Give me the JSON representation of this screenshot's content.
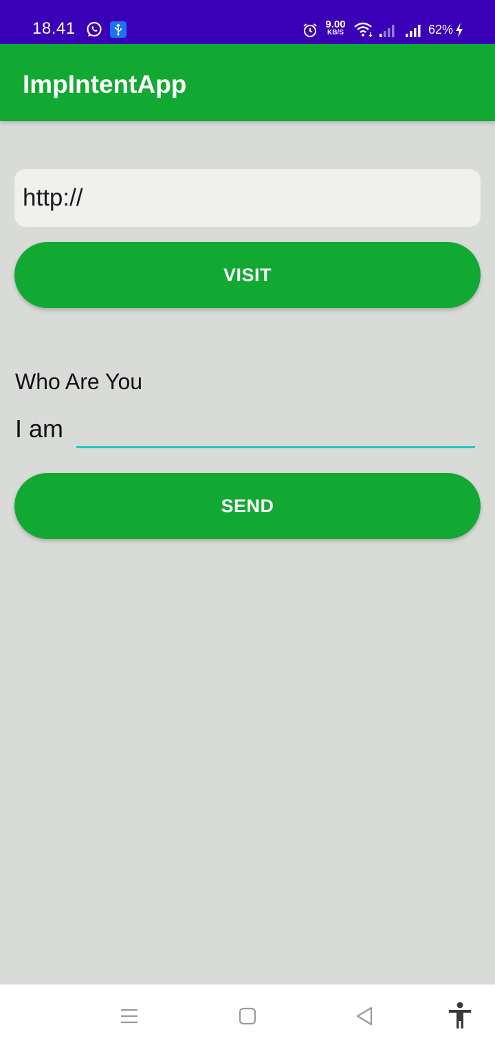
{
  "status_bar": {
    "time": "18.41",
    "net_speed_value": "9.00",
    "net_speed_unit": "KB/S",
    "battery_percent": "62%",
    "background_color": "#3a00b8",
    "icons": [
      "whatsapp-icon",
      "usb-icon",
      "alarm-icon",
      "wifi-icon",
      "signal-icon",
      "signal-icon",
      "charging-icon"
    ]
  },
  "app_bar": {
    "title": "ImpIntentApp",
    "color": "#12a932"
  },
  "url_input": {
    "value": "http://",
    "placeholder": ""
  },
  "visit_button": {
    "label": "VISIT"
  },
  "who_section": {
    "heading": "Who Are You",
    "prefix": "I am",
    "input_value": "",
    "underline_color": "#1fcabf"
  },
  "send_button": {
    "label": "SEND"
  },
  "nav_bar": {
    "icons": [
      "menu-icon",
      "home-icon",
      "back-icon",
      "accessibility-icon"
    ]
  }
}
